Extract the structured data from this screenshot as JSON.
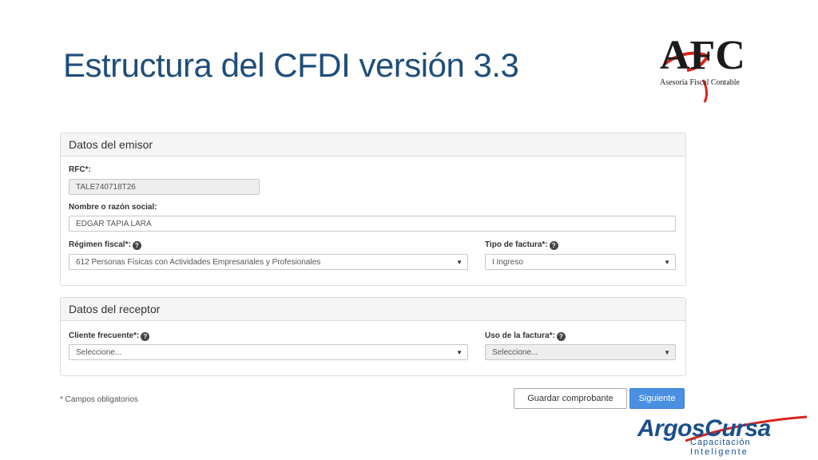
{
  "slide": {
    "title": "Estructura del CFDI versión 3.3"
  },
  "logo_afc": {
    "letters": "AFC",
    "subtitle": "Asesoría Fiscal  Contable"
  },
  "emisor": {
    "heading": "Datos del emisor",
    "rfc_label": "RFC*:",
    "rfc_value": "TALE740718T26",
    "nombre_label": "Nombre o razón social:",
    "nombre_value": "EDGAR TAPIA LARA",
    "regimen_label": "Régimen fiscal*:",
    "regimen_value": "612 Personas Físicas con Actividades Empresariales y Profesionales",
    "tipo_label": "Tipo de factura*:",
    "tipo_value": "I Ingreso"
  },
  "receptor": {
    "heading": "Datos del receptor",
    "cliente_label": "Cliente frecuente*:",
    "cliente_value": "Seleccione...",
    "uso_label": "Uso de la factura*:",
    "uso_value": "Seleccione..."
  },
  "footer": {
    "note": "* Campos obligatorios",
    "save_label": "Guardar comprobante",
    "next_label": "Siguiente"
  },
  "logo_argos": {
    "word": "ArgosCursa",
    "tag1": "Capacitación",
    "tag2": "Inteligente"
  },
  "icons": {
    "help": "question-circle-icon",
    "caret": "caret-down-icon"
  },
  "colors": {
    "title": "#1f4e79",
    "primary_button": "#4a90e2",
    "logo_red": "#d7261e",
    "argos_blue": "#1b4f8c"
  }
}
